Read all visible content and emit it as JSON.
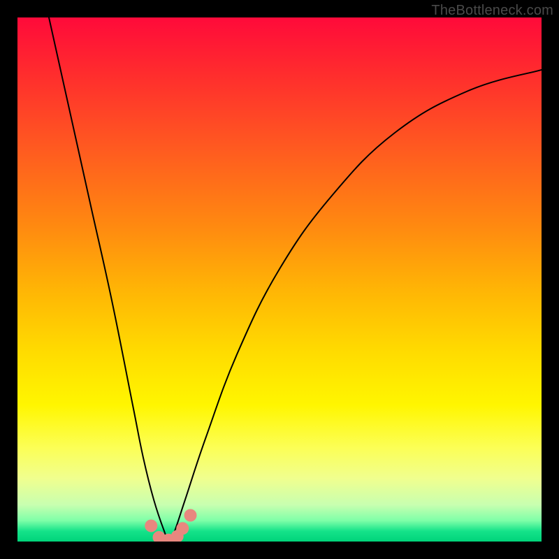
{
  "watermark": "TheBottleneck.com",
  "chart_data": {
    "type": "line",
    "title": "",
    "xlabel": "",
    "ylabel": "",
    "xlim": [
      0,
      100
    ],
    "ylim": [
      0,
      100
    ],
    "legend": false,
    "grid": false,
    "background_gradient": {
      "stops": [
        {
          "pos": 0.0,
          "color": "#ff0a3a"
        },
        {
          "pos": 0.5,
          "color": "#ffb000"
        },
        {
          "pos": 0.8,
          "color": "#fcff55"
        },
        {
          "pos": 0.97,
          "color": "#40e790"
        },
        {
          "pos": 1.0,
          "color": "#00d47a"
        }
      ]
    },
    "series": [
      {
        "name": "bottleneck-curve",
        "color": "#000000",
        "stroke_width": 2,
        "x": [
          6,
          10,
          14,
          18,
          22,
          24,
          26,
          28,
          29,
          30,
          32,
          36,
          42,
          50,
          60,
          72,
          86,
          100
        ],
        "y": [
          100,
          82,
          64,
          46,
          26,
          16,
          8,
          2,
          0,
          2,
          8,
          20,
          36,
          52,
          66,
          78,
          86,
          90
        ]
      }
    ],
    "markers": [
      {
        "name": "dip-marker",
        "color": "#e8877f",
        "x": 25.5,
        "y": 3.0
      },
      {
        "name": "dip-marker",
        "color": "#e8877f",
        "x": 27.0,
        "y": 0.8
      },
      {
        "name": "dip-marker",
        "color": "#e8877f",
        "x": 28.8,
        "y": 0.3
      },
      {
        "name": "dip-marker",
        "color": "#e8877f",
        "x": 30.5,
        "y": 1.0
      },
      {
        "name": "dip-marker",
        "color": "#e8877f",
        "x": 31.5,
        "y": 2.5
      },
      {
        "name": "dip-marker",
        "color": "#e8877f",
        "x": 33.0,
        "y": 5.0
      }
    ]
  }
}
